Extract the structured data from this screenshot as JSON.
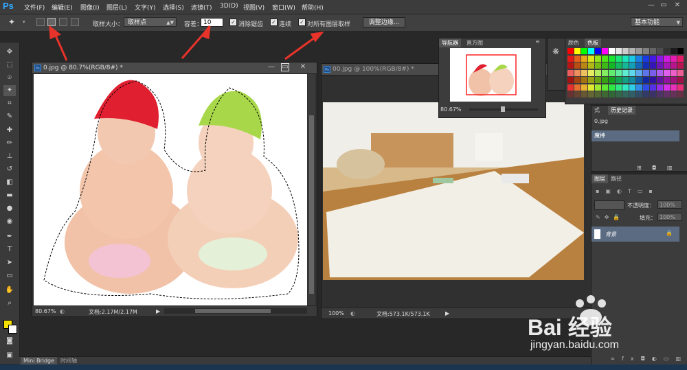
{
  "app": {
    "logo": "Ps"
  },
  "menu": {
    "items": [
      "文件(F)",
      "编辑(E)",
      "图像(I)",
      "图层(L)",
      "文字(Y)",
      "选择(S)",
      "滤镜(T)",
      "3D(D)",
      "视图(V)",
      "窗口(W)",
      "帮助(H)"
    ]
  },
  "window_controls": {
    "minimize": "—",
    "restore": "▭",
    "close": "✕"
  },
  "options": {
    "sample_size_label": "取样大小：",
    "sample_size_value": "取样点",
    "tolerance_label": "容差：",
    "tolerance_value": "10",
    "antialias_label": "消除锯齿",
    "contiguous_label": "连续",
    "all_layers_label": "对所有图层取样",
    "refine_edge_label": "调整边缘...",
    "workspace_value": "基本功能"
  },
  "doc1": {
    "title": "0.jpg @ 80.7%(RGB/8#) *",
    "zoom": "80.67%",
    "doc_size": "文档:2.17M/2.17M"
  },
  "doc2": {
    "title": "00.jpg @ 100%(RGB/8#) *",
    "zoom": "100%",
    "doc_size": "文档:573.1K/573.1K"
  },
  "navigator": {
    "tabs": [
      "导航器",
      "直方图"
    ],
    "zoom": "80.67%"
  },
  "swatches_panel": {
    "tabs": [
      "颜色",
      "色板"
    ]
  },
  "history_panel": {
    "tabs": [
      "式",
      "历史记录"
    ],
    "items": [
      "0.jpg",
      "魔棒"
    ]
  },
  "layers_panel": {
    "tabs": [
      "图层",
      "路径"
    ],
    "opacity_label": "不透明度：",
    "opacity_value": "100%",
    "fill_label": "填充：",
    "fill_value": "100%",
    "layer_name": "背景"
  },
  "bottom_bar": {
    "tabs": [
      "Mini Bridge",
      "时间轴"
    ]
  },
  "watermark": {
    "line1": "Bai 经验",
    "line2": "jingyan.baidu.com"
  },
  "colors": {
    "accent_arrow": "#e8332a",
    "foreground": "#f5e000",
    "background": "#ffffff"
  }
}
